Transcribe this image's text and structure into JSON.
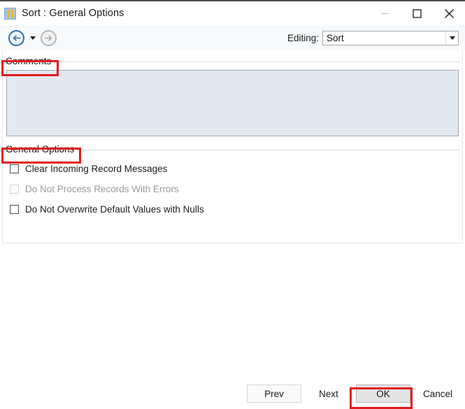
{
  "window": {
    "title": "Sort : General Options",
    "icon": "sort-arrows-icon",
    "controls": {
      "minimize": "minimize-icon",
      "maximize": "maximize-icon",
      "close": "close-icon"
    }
  },
  "toolbar": {
    "back": "back-arrow-icon",
    "back_dropdown": "chevron-down-icon",
    "forward": "forward-arrow-icon",
    "editing_label": "Editing:",
    "editing_value": "Sort",
    "editing_dropdown": "chevron-down-icon"
  },
  "comments": {
    "group_title": "Comments",
    "value": "",
    "placeholder": ""
  },
  "general_options": {
    "group_title": "General Options",
    "checkboxes": [
      {
        "label": "Clear Incoming Record Messages",
        "checked": false,
        "disabled": false
      },
      {
        "label": "Do Not Process Records With Errors",
        "checked": false,
        "disabled": true
      },
      {
        "label": "Do Not Overwrite Default Values with Nulls",
        "checked": false,
        "disabled": false
      }
    ]
  },
  "footer": {
    "prev": "Prev",
    "next": "Next",
    "ok": "OK",
    "cancel": "Cancel"
  },
  "annotations": {
    "accent_color": "#e01b1b",
    "highlighted": [
      "Comments",
      "General Options",
      "OK"
    ]
  }
}
